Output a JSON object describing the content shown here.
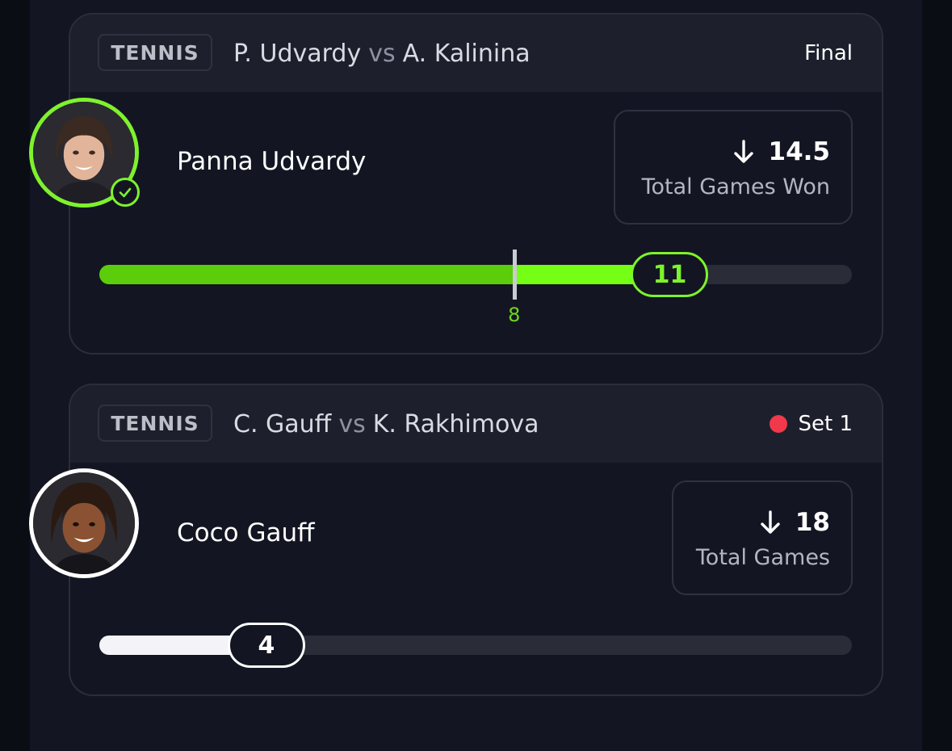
{
  "colors": {
    "accent_green": "#7ef22d",
    "bar_green": "#5ccd0b",
    "live_red": "#f0394a",
    "card_bg": "#131622",
    "header_bg": "#1d202c"
  },
  "cards": [
    {
      "sport": "TENNIS",
      "player_a": "P. Udvardy",
      "vs": "vs",
      "player_b": "A. Kalinina",
      "status": "Final",
      "live": false,
      "player_name": "Panna Udvardy",
      "avatar_icon": "player-avatar-icon",
      "check_icon": "check-circle-icon",
      "stat": {
        "direction_icon": "arrow-down-icon",
        "line": "14.5",
        "label": "Total Games Won"
      },
      "progress": {
        "current": "11",
        "current_value": 11,
        "marker_label": "8",
        "marker_value": 8,
        "fill_fraction": 0.758
      }
    },
    {
      "sport": "TENNIS",
      "player_a": "C. Gauff",
      "vs": "vs",
      "player_b": "K. Rakhimova",
      "status": "Set 1",
      "live": true,
      "player_name": "Coco Gauff",
      "avatar_icon": "player-avatar-icon",
      "stat": {
        "direction_icon": "arrow-down-icon",
        "line": "18",
        "label": "Total Games"
      },
      "progress": {
        "current": "4",
        "current_value": 4,
        "fill_fraction": 0.222
      }
    }
  ]
}
